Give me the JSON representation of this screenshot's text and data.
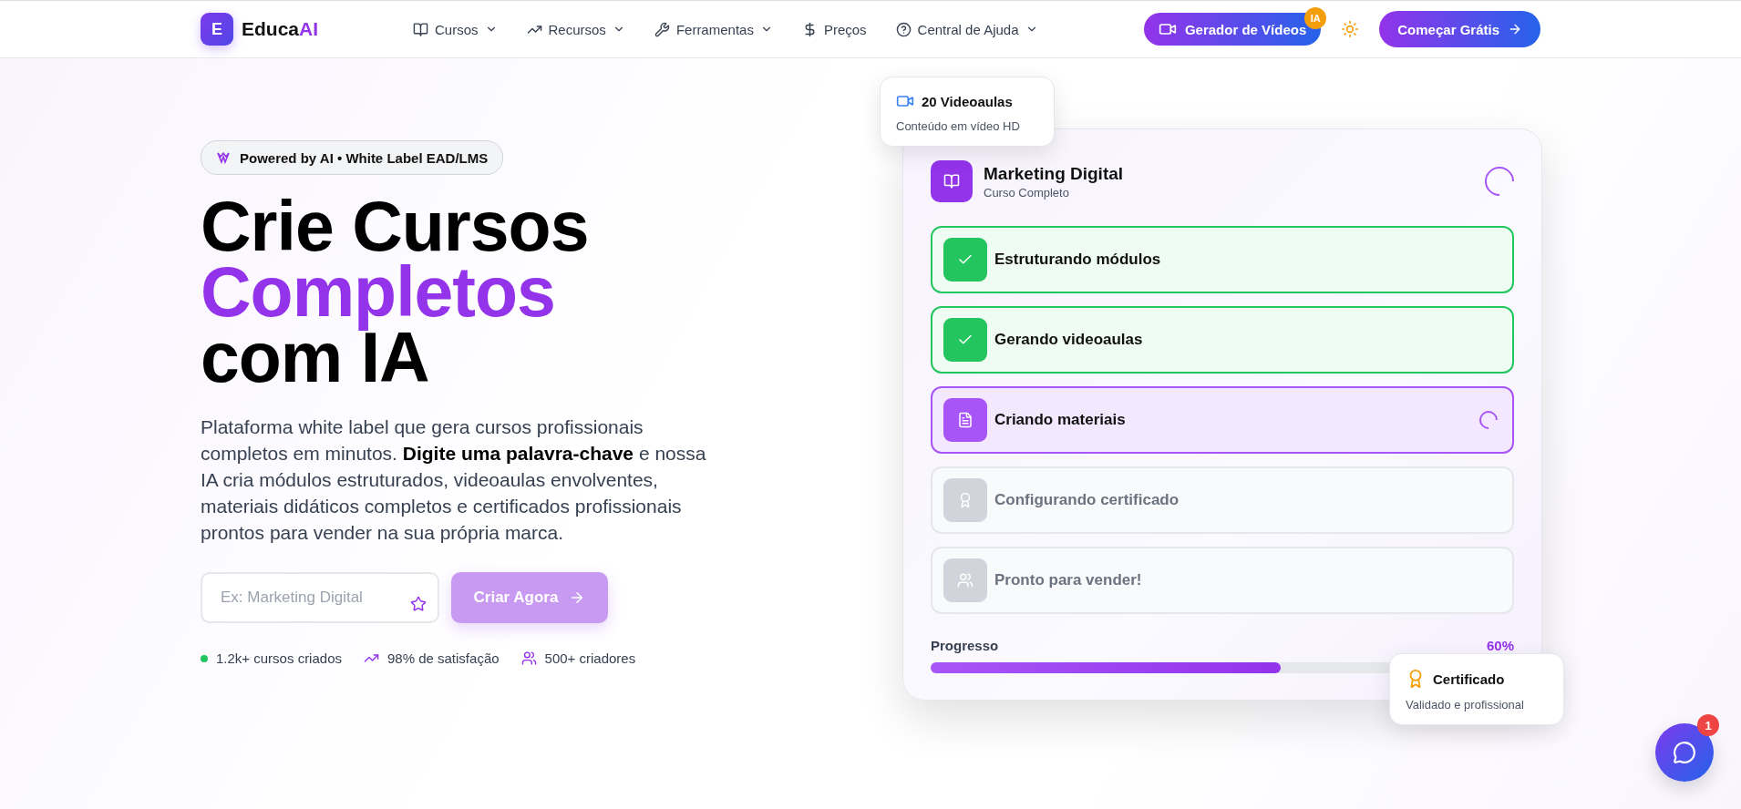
{
  "header": {
    "logo": {
      "letter": "E",
      "name_start": "Educa",
      "name_accent": "AI"
    },
    "nav": [
      {
        "label": "Cursos",
        "kind": "book",
        "dropdown": true
      },
      {
        "label": "Recursos",
        "kind": "trend",
        "dropdown": true
      },
      {
        "label": "Ferramentas",
        "kind": "wrench",
        "dropdown": true
      },
      {
        "label": "Preços",
        "kind": "dollar",
        "dropdown": false
      },
      {
        "label": "Central de Ajuda",
        "kind": "help",
        "dropdown": true
      }
    ],
    "video_button": {
      "label": "Gerador de Vídeos",
      "badge": "IA"
    },
    "cta": "Começar Grátis"
  },
  "hero": {
    "badge": "Powered by AI • White Label EAD/LMS",
    "title_lines": [
      {
        "text": "Crie Cursos",
        "accent": false
      },
      {
        "text": "Completos",
        "accent": true
      },
      {
        "text": "com IA",
        "accent": false
      }
    ],
    "description": "Plataforma white label que gera cursos profissionais completos em minutos. **Digite uma palavra-chave** e nossa IA cria módulos estruturados, videoaulas envolventes, materiais didáticos completos e certificados profissionais prontos para vender na sua própria marca.",
    "input": {
      "placeholder": "Ex: Marketing Digital"
    },
    "button": {
      "label": "Criar Agora",
      "disabled": true
    },
    "stats": [
      {
        "kind": "dot",
        "text": "1.2k+ cursos criados"
      },
      {
        "kind": "trend",
        "text": "98% de satisfação"
      },
      {
        "kind": "users",
        "text": "500+ criadores"
      }
    ]
  },
  "card": {
    "title": "Marketing Digital",
    "subtitle": "Curso Completo",
    "steps": [
      {
        "label": "Estruturando módulos",
        "kind": "done"
      },
      {
        "label": "Gerando videoaulas",
        "kind": "done"
      },
      {
        "label": "Criando materiais",
        "kind": "active"
      },
      {
        "label": "Configurando certificado",
        "kind": "pending"
      },
      {
        "label": "Pronto para vender!",
        "kind": "pending"
      }
    ],
    "progress": {
      "label": "Progresso",
      "reading": "60%",
      "level": 0.6
    }
  },
  "floating_videos": {
    "title": "20 Videoaulas",
    "subtitle": "Conteúdo em vídeo HD"
  },
  "floating_certificate": {
    "title": "Certificado",
    "subtitle": "Validado e profissional"
  },
  "chat": {
    "badge": "1"
  }
}
